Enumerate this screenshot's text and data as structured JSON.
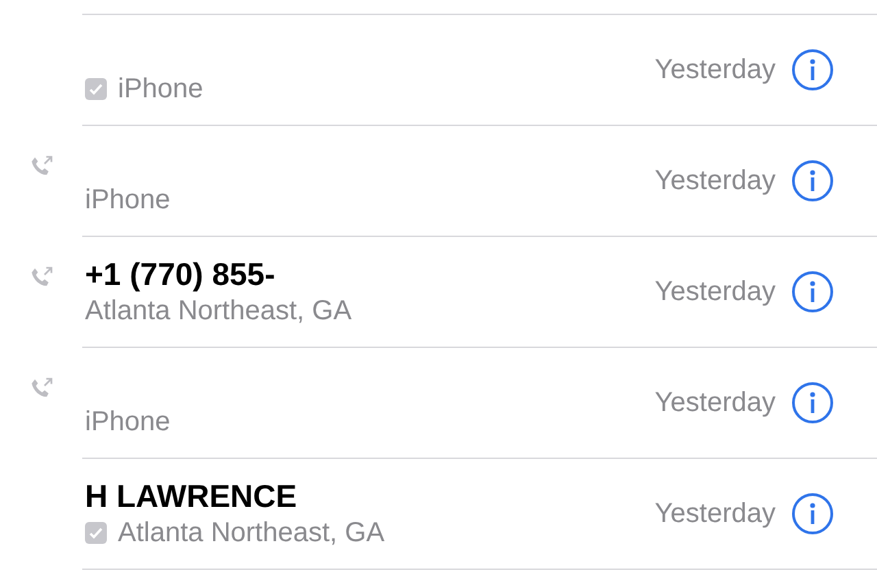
{
  "calls": [
    {
      "outgoing": false,
      "verified": true,
      "subtitle": "iPhone",
      "time": "Yesterday"
    },
    {
      "outgoing": true,
      "verified": false,
      "subtitle": "iPhone",
      "time": "Yesterday"
    },
    {
      "outgoing": true,
      "verified": false,
      "name": "+1 (770) 855-",
      "subtitle": "Atlanta Northeast, GA",
      "time": "Yesterday"
    },
    {
      "outgoing": true,
      "verified": false,
      "subtitle": "iPhone",
      "time": "Yesterday"
    },
    {
      "outgoing": false,
      "verified": true,
      "name": "H LAWRENCE",
      "subtitle": "Atlanta Northeast, GA",
      "time": "Yesterday"
    }
  ]
}
